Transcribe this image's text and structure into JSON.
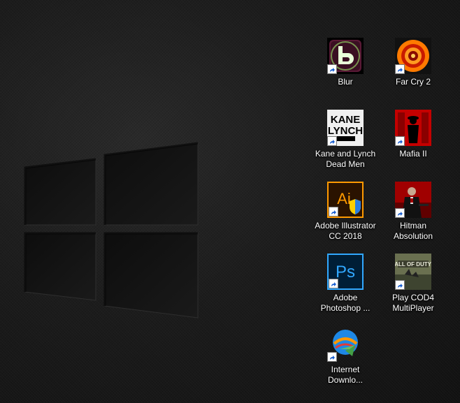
{
  "desktop": {
    "icons": [
      {
        "label": "Blur",
        "icon": "blur-icon",
        "colors": {
          "bg": "#5a1a36",
          "fg": "#9ee86a"
        }
      },
      {
        "label": "Far Cry 2",
        "icon": "far-cry-2-icon",
        "colors": {
          "bg": "#ff7a00",
          "fg": "#c81a00"
        }
      },
      {
        "label": "Kane and Lynch\nDead Men",
        "icon": "kane-lynch-icon",
        "logo_text": "KANE&LYNCH",
        "colors": {
          "bg": "#f0f0f0",
          "fg": "#000000"
        }
      },
      {
        "label": "Mafia II",
        "icon": "mafia-ii-icon",
        "colors": {
          "bg": "#c40000",
          "fg": "#000000"
        }
      },
      {
        "label": "Adobe Illustrator\nCC 2018",
        "icon": "adobe-illustrator-icon",
        "logo_text": "Ai",
        "colors": {
          "bg": "#2a1300",
          "fg": "#ff9a00"
        }
      },
      {
        "label": "Hitman\nAbsolution",
        "icon": "hitman-absolution-icon",
        "colors": {
          "bg": "#a00000",
          "fg": "#111111"
        }
      },
      {
        "label": "Adobe\nPhotoshop ...",
        "icon": "adobe-photoshop-icon",
        "logo_text": "Ps",
        "colors": {
          "bg": "#001e36",
          "fg": "#31a8ff"
        }
      },
      {
        "label": "Play COD4\nMultiPlayer",
        "icon": "cod4-icon",
        "colors": {
          "bg": "#5c6448",
          "fg": "#d8d8c0"
        }
      },
      {
        "label": "Internet\nDownlo...",
        "icon": "internet-download-manager-icon",
        "colors": {
          "bg": "#ffffff",
          "fg": "#1e88e5"
        }
      }
    ],
    "shortcut_overlay": "shortcut-arrow-icon"
  }
}
